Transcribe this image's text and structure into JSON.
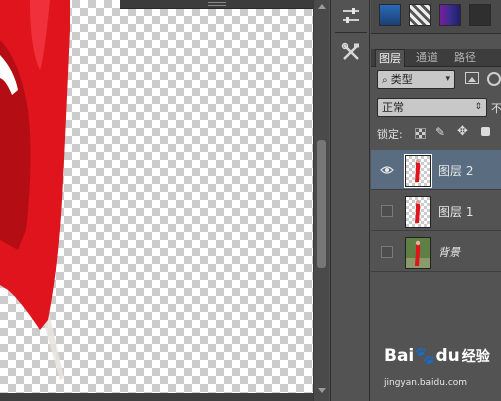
{
  "panel": {
    "tabs": [
      {
        "label": "图层",
        "active": true
      },
      {
        "label": "通道",
        "active": false
      },
      {
        "label": "路径",
        "active": false
      }
    ],
    "filter_label": "类型",
    "blend_mode": "正常",
    "opacity_prefix": "不",
    "lock_label": "锁定:"
  },
  "layers": [
    {
      "name": "图层 2",
      "visible": true,
      "selected": true
    },
    {
      "name": "图层 1",
      "visible": false,
      "selected": false
    },
    {
      "name": "背景",
      "visible": false,
      "selected": false
    }
  ],
  "watermark": {
    "brand_prefix": "Bai",
    "brand_paw": "🐾",
    "brand_suffix": "du",
    "brand_cn": "经验",
    "url": "jingyan.baidu.com"
  },
  "colors": {
    "accent_selected": "#596c80",
    "panel_bg": "#535353",
    "flag_red": "#e0141c"
  },
  "icons": [
    "sliders-icon",
    "tools-icon",
    "eye-icon",
    "search-icon",
    "lock-pixels-icon",
    "lock-brush-icon",
    "lock-move-icon",
    "lock-all-icon"
  ]
}
